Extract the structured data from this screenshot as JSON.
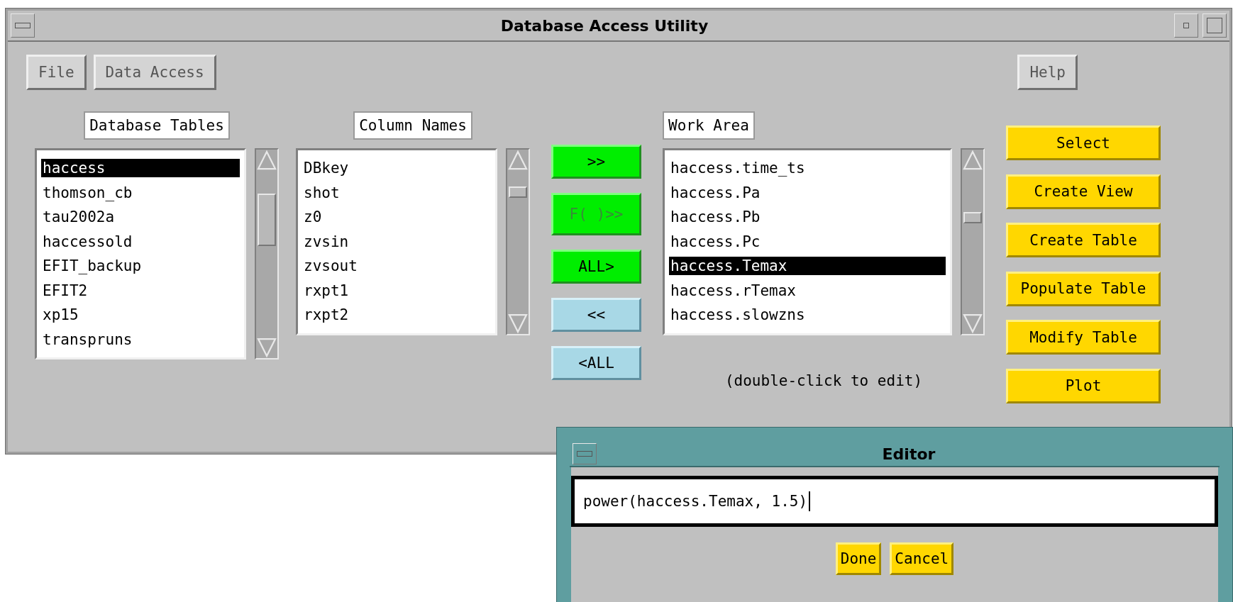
{
  "window": {
    "title": "Database Access Utility"
  },
  "menu": [
    {
      "label": "File"
    },
    {
      "label": "Data Access"
    }
  ],
  "help_button": "Help",
  "lists": [
    {
      "label": "Database Tables",
      "items": [
        {
          "text": "haccess",
          "selected": true
        },
        {
          "text": "thomson_cb",
          "selected": false
        },
        {
          "text": "tau2002a",
          "selected": false
        },
        {
          "text": "haccessold",
          "selected": false
        },
        {
          "text": "EFIT_backup",
          "selected": false
        },
        {
          "text": "EFIT2",
          "selected": false
        },
        {
          "text": "xp15",
          "selected": false
        },
        {
          "text": "transpruns",
          "selected": false
        }
      ]
    },
    {
      "label": "Column Names",
      "items": [
        {
          "text": "DBkey",
          "selected": false
        },
        {
          "text": "shot",
          "selected": false
        },
        {
          "text": "z0",
          "selected": false
        },
        {
          "text": "zvsin",
          "selected": false
        },
        {
          "text": "zvsout",
          "selected": false
        },
        {
          "text": "rxpt1",
          "selected": false
        },
        {
          "text": "rxpt2",
          "selected": false
        }
      ]
    },
    {
      "label": "Work Area",
      "items": [
        {
          "text": "haccess.time_ts",
          "selected": false
        },
        {
          "text": "haccess.Pa",
          "selected": false
        },
        {
          "text": "haccess.Pb",
          "selected": false
        },
        {
          "text": "haccess.Pc",
          "selected": false
        },
        {
          "text": "haccess.Temax",
          "selected": true
        },
        {
          "text": "haccess.rTemax",
          "selected": false
        },
        {
          "text": "haccess.slowzns",
          "selected": false
        }
      ]
    }
  ],
  "transfer_buttons": [
    {
      "label": ">>",
      "kind": "add",
      "disabled": false
    },
    {
      "label": "F( )>>",
      "kind": "add",
      "disabled": true
    },
    {
      "label": "ALL>",
      "kind": "add",
      "disabled": false
    },
    {
      "label": "<<",
      "kind": "remove",
      "disabled": false
    },
    {
      "label": "<ALL",
      "kind": "remove",
      "disabled": false
    }
  ],
  "actions": [
    "Select",
    "Create View",
    "Create Table",
    "Populate Table",
    "Modify Table",
    "Plot"
  ],
  "hint": "(double-click to edit)",
  "editor": {
    "title": "Editor",
    "value": "power(haccess.Temax, 1.5)",
    "buttons": [
      "Done",
      "Cancel"
    ]
  }
}
